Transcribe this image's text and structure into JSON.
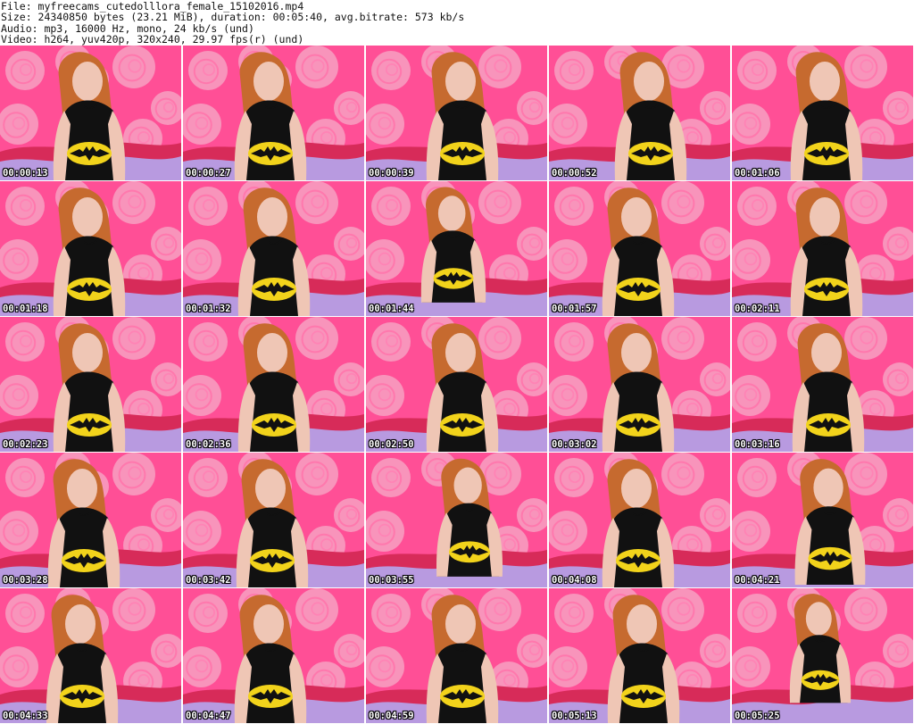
{
  "header": {
    "file_line": "File: myfreecams_cutedolllora_female_15102016.mp4",
    "size_line": "Size: 24340850 bytes (23.21 MiB), duration: 00:05:40, avg.bitrate: 573 kb/s",
    "audio_line": "Audio: mp3, 16000 Hz, mono, 24 kb/s (und)",
    "video_line": "Video: h264, yuv420p, 320x240, 29.97 fps(r) (und)"
  },
  "thumbnails": [
    {
      "timestamp": "00:00:13"
    },
    {
      "timestamp": "00:00:27"
    },
    {
      "timestamp": "00:00:39"
    },
    {
      "timestamp": "00:00:52"
    },
    {
      "timestamp": "00:01:06"
    },
    {
      "timestamp": "00:01:18"
    },
    {
      "timestamp": "00:01:32"
    },
    {
      "timestamp": "00:01:44"
    },
    {
      "timestamp": "00:01:57"
    },
    {
      "timestamp": "00:02:11"
    },
    {
      "timestamp": "00:02:23"
    },
    {
      "timestamp": "00:02:36"
    },
    {
      "timestamp": "00:02:50"
    },
    {
      "timestamp": "00:03:02"
    },
    {
      "timestamp": "00:03:16"
    },
    {
      "timestamp": "00:03:28"
    },
    {
      "timestamp": "00:03:42"
    },
    {
      "timestamp": "00:03:55"
    },
    {
      "timestamp": "00:04:08"
    },
    {
      "timestamp": "00:04:21"
    },
    {
      "timestamp": "00:04:33"
    },
    {
      "timestamp": "00:04:47"
    },
    {
      "timestamp": "00:04:59"
    },
    {
      "timestamp": "00:05:13"
    },
    {
      "timestamp": "00:05:25"
    }
  ],
  "colors": {
    "background": "#ffffff",
    "wall_pink": "#ff4f96",
    "rose_pink": "#f7a3c3",
    "bed_purple": "#b89ae0",
    "shirt_black": "#111111",
    "logo_yellow": "#f2d31b",
    "hair_orange": "#c66a2f"
  }
}
